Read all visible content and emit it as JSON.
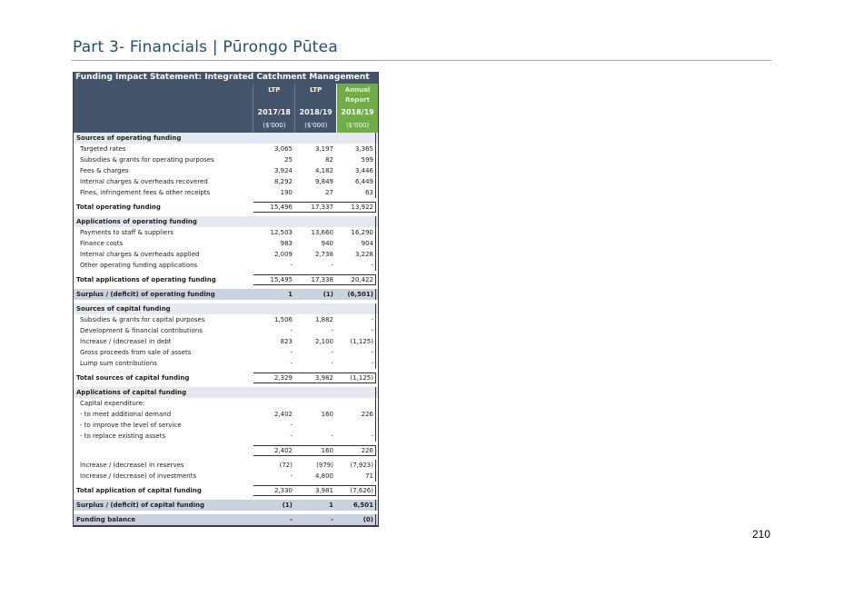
{
  "header": {
    "page_title": "Part 3- Financials | Pūrongo Pūtea"
  },
  "page_number": "210",
  "table": {
    "title": "Funding Impact Statement: Integrated Catchment Management",
    "columns": [
      {
        "top": "LTP",
        "top2": "",
        "year": "2017/18",
        "unit": "($'000)"
      },
      {
        "top": "LTP",
        "top2": "",
        "year": "2018/19",
        "unit": "($'000)"
      },
      {
        "top": "Annual",
        "top2": "Report",
        "year": "2018/19",
        "unit": "($'000)"
      }
    ],
    "rows": [
      {
        "kind": "section",
        "label": "Sources of operating funding",
        "values": [
          "",
          "",
          ""
        ]
      },
      {
        "kind": "item",
        "label": "Targeted rates",
        "values": [
          "3,065",
          "3,197",
          "3,365"
        ]
      },
      {
        "kind": "item",
        "label": "Subsidies & grants for operating purposes",
        "values": [
          "25",
          "82",
          "599"
        ]
      },
      {
        "kind": "item",
        "label": "Fees & charges",
        "values": [
          "3,924",
          "4,182",
          "3,446"
        ]
      },
      {
        "kind": "item",
        "label": "Internal charges & overheads recovered",
        "values": [
          "8,292",
          "9,849",
          "6,449"
        ]
      },
      {
        "kind": "item",
        "label": "Fines, infringement fees & other receipts",
        "values": [
          "190",
          "27",
          "63"
        ]
      },
      {
        "kind": "spacer"
      },
      {
        "kind": "total",
        "label": "Total operating funding",
        "values": [
          "15,496",
          "17,337",
          "13,922"
        ]
      },
      {
        "kind": "spacer"
      },
      {
        "kind": "section",
        "label": "Applications of operating funding",
        "values": [
          "",
          "",
          ""
        ]
      },
      {
        "kind": "item",
        "label": "Payments to staff & suppliers",
        "values": [
          "12,503",
          "13,660",
          "16,290"
        ]
      },
      {
        "kind": "item",
        "label": "Finance costs",
        "values": [
          "983",
          "940",
          "904"
        ]
      },
      {
        "kind": "item",
        "label": "Internal charges & overheads applied",
        "values": [
          "2,009",
          "2,738",
          "3,228"
        ]
      },
      {
        "kind": "item",
        "label": "Other operating funding applications",
        "values": [
          "-",
          "-",
          "-"
        ]
      },
      {
        "kind": "spacer"
      },
      {
        "kind": "total",
        "label": "Total applications of operating funding",
        "values": [
          "15,495",
          "17,338",
          "20,422"
        ]
      },
      {
        "kind": "spacer"
      },
      {
        "kind": "shaded",
        "label": "Surplus / (deficit) of operating funding",
        "values": [
          "1",
          "(1)",
          "(6,501)"
        ]
      },
      {
        "kind": "spacer"
      },
      {
        "kind": "section",
        "label": "Sources of capital funding",
        "values": [
          "",
          "",
          ""
        ]
      },
      {
        "kind": "item",
        "label": "Subsidies & grants for capital purposes",
        "values": [
          "1,506",
          "1,882",
          "-"
        ]
      },
      {
        "kind": "item",
        "label": "Development & financial contributions",
        "values": [
          "-",
          "-",
          "-"
        ]
      },
      {
        "kind": "item",
        "label": "Increase / (decrease) in debt",
        "values": [
          "823",
          "2,100",
          "(1,125)"
        ]
      },
      {
        "kind": "item",
        "label": "Gross proceeds from sale of assets",
        "values": [
          "-",
          "-",
          "-"
        ]
      },
      {
        "kind": "item",
        "label": "Lump sum contributions",
        "values": [
          "-",
          "-",
          "-"
        ]
      },
      {
        "kind": "spacer"
      },
      {
        "kind": "total",
        "label": "Total sources of capital funding",
        "values": [
          "2,329",
          "3,982",
          "(1,125)"
        ]
      },
      {
        "kind": "spacer"
      },
      {
        "kind": "section",
        "label": "Applications of capital funding",
        "values": [
          "",
          "",
          ""
        ]
      },
      {
        "kind": "item",
        "label": "Capital expenditure:",
        "values": [
          "",
          "",
          ""
        ]
      },
      {
        "kind": "item",
        "label": "- to meet additional demand",
        "values": [
          "2,402",
          "160",
          "226"
        ]
      },
      {
        "kind": "item",
        "label": "- to improve the level of service",
        "values": [
          "-",
          "",
          ""
        ]
      },
      {
        "kind": "item",
        "label": "- to replace existing assets",
        "values": [
          "-",
          "-",
          "-"
        ]
      },
      {
        "kind": "spacer"
      },
      {
        "kind": "subtotal",
        "label": "",
        "values": [
          "2,402",
          "160",
          "226"
        ]
      },
      {
        "kind": "spacer"
      },
      {
        "kind": "item",
        "label": "Increase / (decrease) in reserves",
        "values": [
          "(72)",
          "(979)",
          "(7,923)"
        ]
      },
      {
        "kind": "item",
        "label": "Increase / (decrease) of investments",
        "values": [
          "-",
          "4,800",
          "71"
        ]
      },
      {
        "kind": "spacer"
      },
      {
        "kind": "total",
        "label": "Total application of capital funding",
        "values": [
          "2,330",
          "3,981",
          "(7,626)"
        ]
      },
      {
        "kind": "spacer"
      },
      {
        "kind": "shaded",
        "label": "Surplus / (deficit) of capital funding",
        "values": [
          "(1)",
          "1",
          "6,501"
        ]
      },
      {
        "kind": "spacer"
      },
      {
        "kind": "shaded",
        "label": "Funding balance",
        "values": [
          "-",
          "-",
          "(0)"
        ]
      }
    ]
  }
}
